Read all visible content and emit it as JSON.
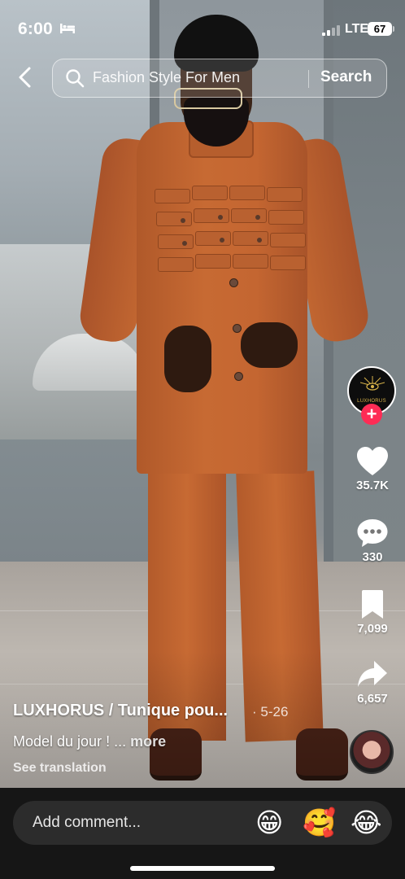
{
  "status_bar": {
    "time": "6:00",
    "network": "LTE",
    "battery": "67"
  },
  "search": {
    "query": "Fashion Style For Men",
    "button_label": "Search"
  },
  "creator": {
    "logo_text": "LUXHORUS"
  },
  "actions": {
    "likes": "35.7K",
    "comments": "330",
    "saves": "7,099",
    "shares": "6,657"
  },
  "caption": {
    "author": "LUXHORUS / Tunique pou...",
    "date": "· 5-26",
    "text": "Model du jour ! ...",
    "more_label": "more",
    "translate_label": "See translation"
  },
  "comment_bar": {
    "placeholder": "Add comment...",
    "emojis": [
      "😁",
      "🥰",
      "😂"
    ]
  },
  "colors": {
    "follow_button": "#fe2c55",
    "suit": "#c46631",
    "bottom_bar": "#161616"
  }
}
